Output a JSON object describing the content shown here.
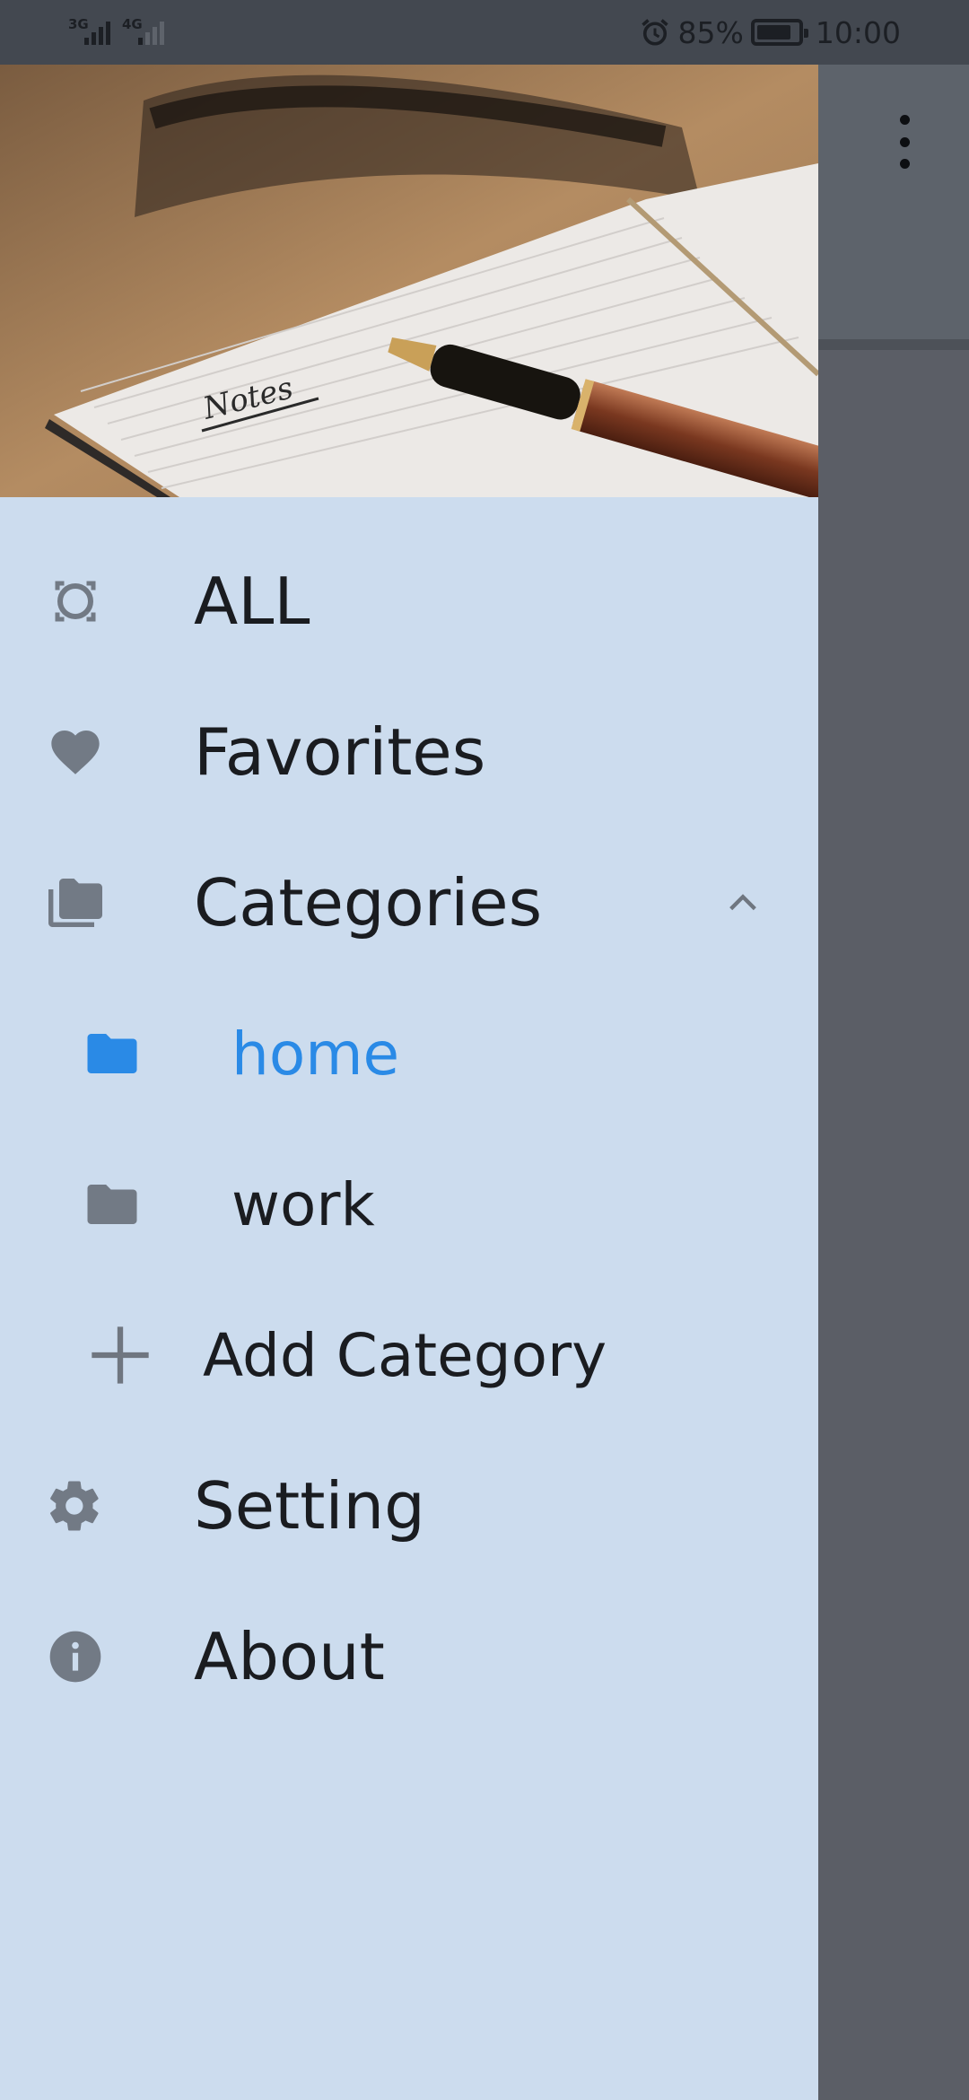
{
  "status_bar": {
    "network_1": "3G",
    "network_2": "4G",
    "battery": "85%",
    "time": "10:00",
    "battery_level": 0.85
  },
  "drawer": {
    "header_image_text": "Notes",
    "items": [
      {
        "label": "ALL",
        "icon": "all-notes-icon"
      },
      {
        "label": "Favorites",
        "icon": "heart-icon"
      },
      {
        "label": "Categories",
        "icon": "folders-icon",
        "expanded": true
      },
      {
        "label": "home",
        "icon": "folder-icon",
        "active": true
      },
      {
        "label": "work",
        "icon": "folder-icon"
      },
      {
        "label": "Add Category",
        "icon": "plus-icon"
      },
      {
        "label": "Setting",
        "icon": "gear-icon"
      },
      {
        "label": "About",
        "icon": "info-icon"
      }
    ]
  },
  "colors": {
    "drawer_bg": "#ccdcee",
    "active": "#2a8ae6",
    "icon": "#727a85",
    "scrim": "#5b5e66"
  }
}
